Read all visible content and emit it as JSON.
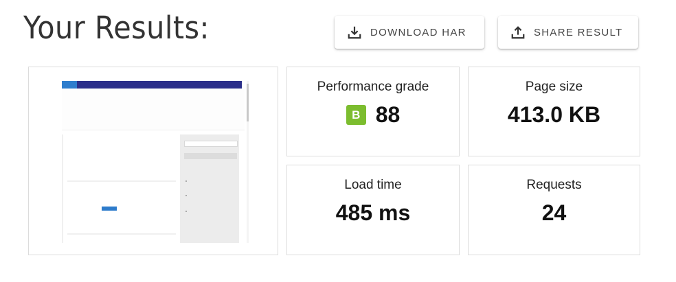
{
  "header": {
    "title": "Your Results:"
  },
  "actions": {
    "download_har": "DOWNLOAD HAR",
    "share_result": "SHARE RESULT"
  },
  "metrics": {
    "performance": {
      "label": "Performance grade",
      "grade": "B",
      "value": "88"
    },
    "page_size": {
      "label": "Page size",
      "value": "413.0 KB"
    },
    "load_time": {
      "label": "Load time",
      "value": "485 ms"
    },
    "requests": {
      "label": "Requests",
      "value": "24"
    }
  },
  "colors": {
    "grade_badge": "#7cbd2f",
    "thumbnail_topbar": "#2b2f8a",
    "thumbnail_accent": "#2e7dcd"
  }
}
